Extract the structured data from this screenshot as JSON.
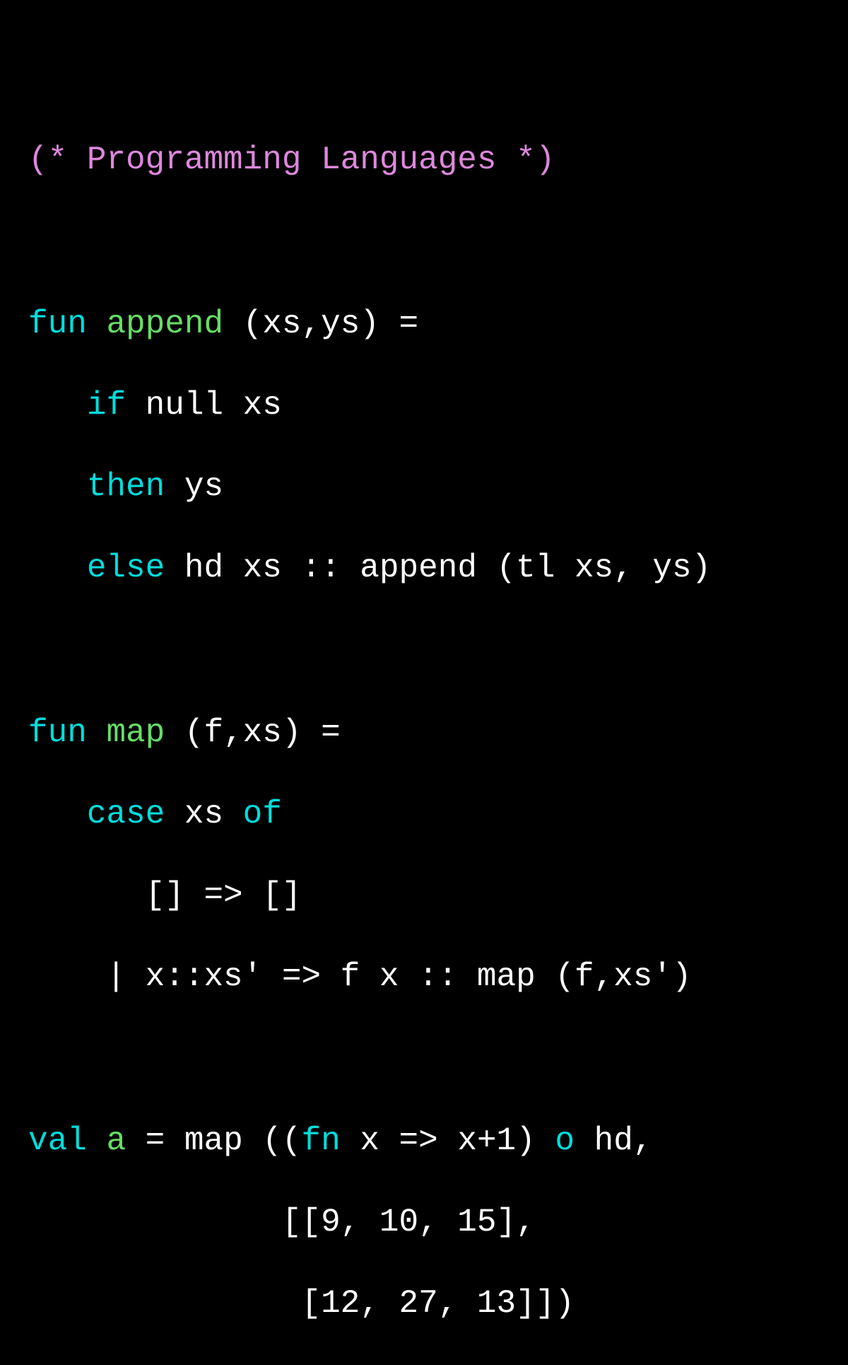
{
  "colors": {
    "comment": "#dd88dd",
    "keyword": "#00dddd",
    "fname": "#66dd66",
    "plain": "#ffffff",
    "bg": "#000000"
  },
  "comment": "(* Programming Languages *)",
  "fun1": {
    "kw_fun": "fun",
    "name": "append",
    "params": " (xs,ys) =",
    "l2a": "   ",
    "l2kw": "if",
    "l2b": " null xs",
    "l3a": "   ",
    "l3kw": "then",
    "l3b": " ys",
    "l4a": "   ",
    "l4kw": "else",
    "l4b": " hd xs :: append (tl xs, ys)"
  },
  "fun2": {
    "kw_fun": "fun",
    "name": "map",
    "params": " (f,xs) =",
    "l2a": "   ",
    "l2kw": "case",
    "l2b": " xs ",
    "l2kw2": "of",
    "l3": "      [] => []",
    "l4": "    | x::xs' => f x :: map (f,xs')"
  },
  "val1": {
    "kw_val": "val",
    "sp1": " ",
    "name": "a",
    "eq": " = map ((",
    "kw_fn": "fn",
    "rest1": " x => x+1) ",
    "kw_o": "o",
    "rest1b": " hd,",
    "l2": "             [[9, 10, 15],",
    "l3": "              [12, 27, 13]])"
  }
}
